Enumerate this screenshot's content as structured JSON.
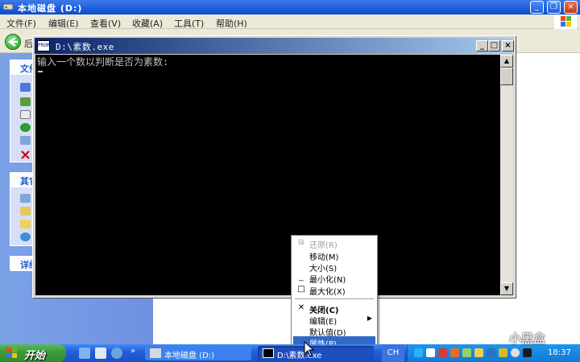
{
  "explorer": {
    "title": "本地磁盘 (D:)",
    "menu": [
      "文件(F)",
      "编辑(E)",
      "查看(V)",
      "收藏(A)",
      "工具(T)",
      "帮助(H)"
    ],
    "back_label": "后",
    "task_pane": {
      "section1": "文件",
      "section2": "其它",
      "section3": "详细"
    }
  },
  "console": {
    "title": "D:\\素数.exe",
    "icon_text": "PROMPT",
    "output_line": "输入一个数以判断是否为素数:",
    "buttons": {
      "minimize": "_",
      "maximize": "□",
      "close": "×"
    }
  },
  "sysmenu": {
    "items": [
      {
        "label": "还原(R)",
        "icon": "⧉",
        "disabled": true
      },
      {
        "label": "移动(M)"
      },
      {
        "label": "大小(S)"
      },
      {
        "label": "最小化(N)",
        "icon": "_"
      },
      {
        "label": "最大化(X)",
        "icon": "□"
      },
      {
        "label": "关闭(C)",
        "icon": "✕",
        "bold": true
      },
      {
        "label": "编辑(E)",
        "submenu": true
      },
      {
        "label": "默认值(D)"
      },
      {
        "label": "属性(P)",
        "highlighted": true
      }
    ]
  },
  "taskbar": {
    "start": "开始",
    "ql_more": "»",
    "tasks": [
      {
        "label": "本地磁盘 (D:)"
      },
      {
        "label": "D:\\素数.exe"
      }
    ],
    "lang": "CH",
    "clock": "18:37"
  },
  "watermark": "小黑盒",
  "colors": {
    "xp_blue": "#245edb",
    "highlight": "#316ac5",
    "console_bg": "#000000",
    "console_fg": "#c0c0c0"
  }
}
